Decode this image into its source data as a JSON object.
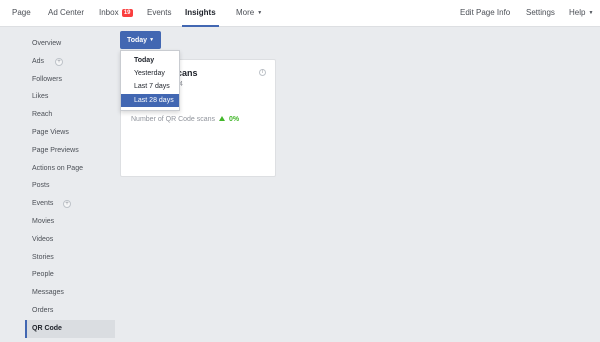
{
  "nav": {
    "page": "Page",
    "ad_center": "Ad Center",
    "inbox": "Inbox",
    "inbox_count": "19",
    "events": "Events",
    "insights": "Insights",
    "more": "More",
    "edit_page_info": "Edit Page Info",
    "settings": "Settings",
    "help": "Help"
  },
  "sidebar": {
    "items": [
      {
        "label": "Overview"
      },
      {
        "label": "Ads"
      },
      {
        "label": "Followers"
      },
      {
        "label": "Likes"
      },
      {
        "label": "Reach"
      },
      {
        "label": "Page Views"
      },
      {
        "label": "Page Previews"
      },
      {
        "label": "Actions on Page"
      },
      {
        "label": "Posts"
      },
      {
        "label": "Events"
      },
      {
        "label": "Movies"
      },
      {
        "label": "Videos"
      },
      {
        "label": "Stories"
      },
      {
        "label": "People"
      },
      {
        "label": "Messages"
      },
      {
        "label": "Orders"
      },
      {
        "label": "QR Code"
      }
    ],
    "active": "QR Code"
  },
  "date_filter": {
    "current": "Today",
    "options": [
      "Today",
      "Yesterday",
      "Last 7 days",
      "Last 28 days"
    ],
    "highlighted": "Last 28 days"
  },
  "card": {
    "title_partial": "cans",
    "subtitle_partial": "4",
    "metric_label": "Number of QR Code scans",
    "metric_change": "0%"
  },
  "colors": {
    "accent": "#4267b2",
    "badge": "#fa3e3e",
    "positive": "#42b72a",
    "background": "#e9ebee"
  },
  "icons": {
    "info": "info-icon",
    "plus": "plus-icon",
    "caret": "caret-down-icon",
    "up_arrow": "up-arrow-icon"
  }
}
